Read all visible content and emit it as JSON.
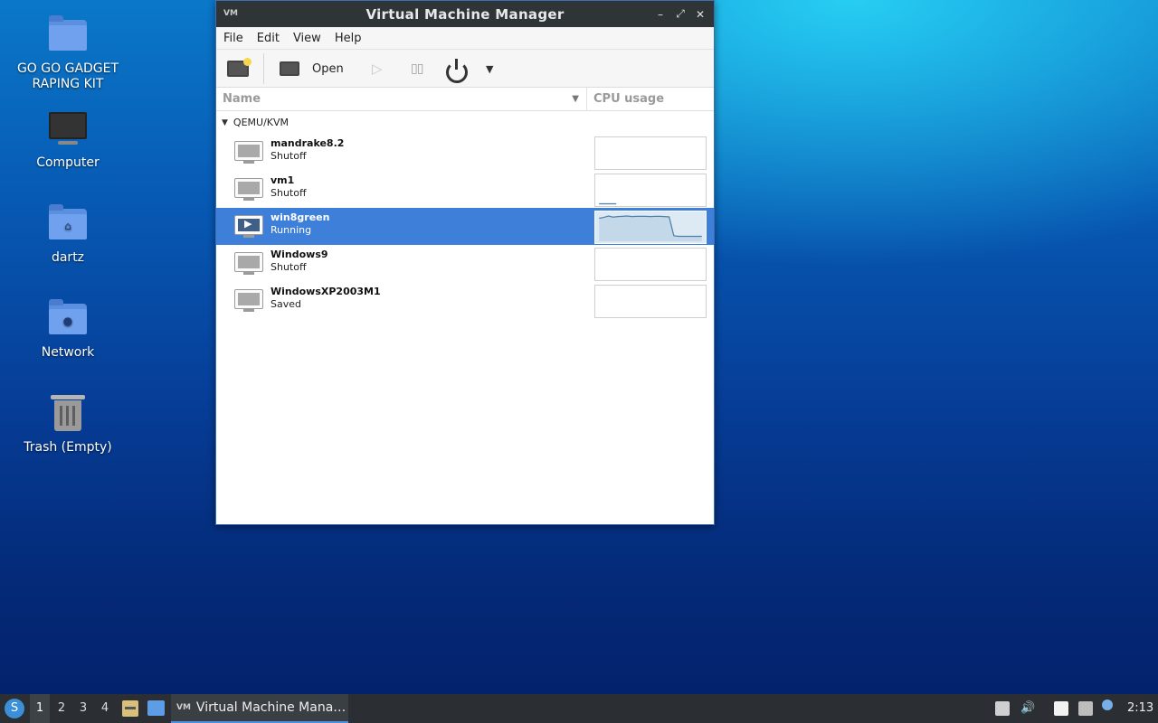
{
  "desktop": {
    "icons": [
      {
        "label": "GO GO GADGET RAPING KIT"
      },
      {
        "label": "Computer"
      },
      {
        "label": "dartz"
      },
      {
        "label": "Network"
      },
      {
        "label": "Trash (Empty)"
      }
    ]
  },
  "window": {
    "title": "Virtual Machine Manager",
    "app_icon_text": "VM",
    "controls": {
      "minimize": "–",
      "maximize": "⤢",
      "close": "✕"
    },
    "menu": [
      "File",
      "Edit",
      "View",
      "Help"
    ],
    "toolbar": {
      "open_label": "Open",
      "run_icon": "▷",
      "pause_icon": "▯▯",
      "dropdown_icon": "▼"
    },
    "columns": {
      "name": "Name",
      "cpu": "CPU usage",
      "sort_icon": "▼"
    },
    "group": {
      "label": "QEMU/KVM",
      "arrow": "▼"
    },
    "vms": [
      {
        "name": "mandrake8.2",
        "state": "Shutoff",
        "cpu_history": []
      },
      {
        "name": "vm1",
        "state": "Shutoff",
        "cpu_history": [
          2,
          2,
          2,
          2,
          2
        ]
      },
      {
        "name": "win8green",
        "state": "Running",
        "cpu_history": [
          82,
          85,
          90,
          86,
          88,
          89,
          90,
          88,
          89,
          89,
          89,
          88,
          89,
          89,
          88,
          87,
          20,
          18,
          18,
          18,
          18,
          18,
          18
        ]
      },
      {
        "name": "Windows9",
        "state": "Shutoff",
        "cpu_history": []
      },
      {
        "name": "WindowsXP2003M1",
        "state": "Saved",
        "cpu_history": []
      }
    ],
    "selected_index": 2
  },
  "taskbar": {
    "start_icon": "S",
    "workspaces": [
      "1",
      "2",
      "3",
      "4"
    ],
    "active_workspace": "1",
    "task_label": "Virtual Machine Mana…",
    "task_icon_text": "VM",
    "volume_icon": "🔊",
    "clock": "2:13"
  }
}
